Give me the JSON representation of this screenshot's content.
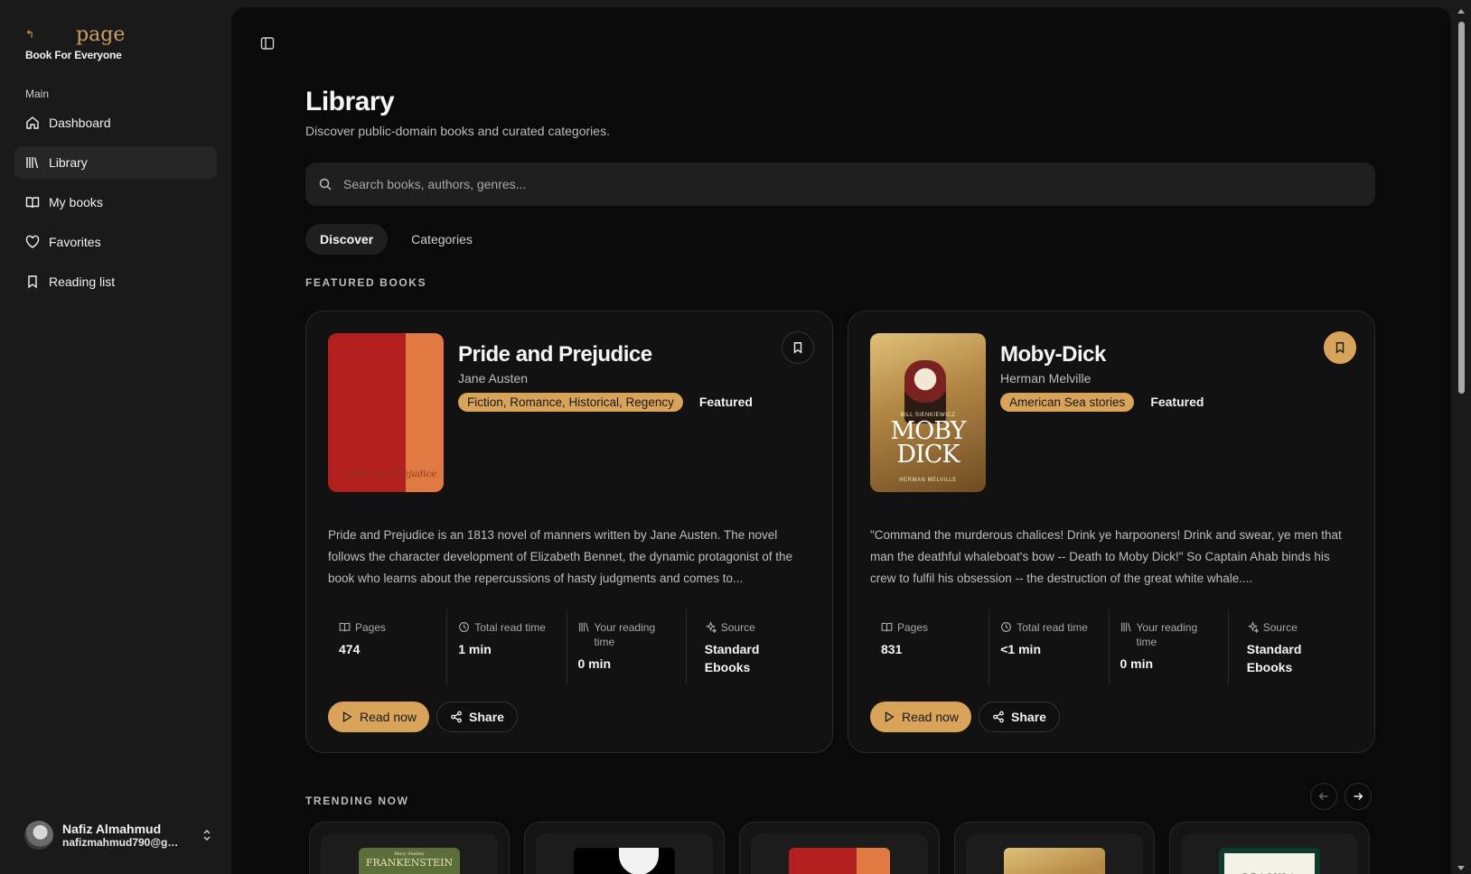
{
  "brand": {
    "logo_word": "page",
    "logo_arrow": "↰",
    "tagline": "Book For Everyone"
  },
  "sidebar": {
    "section_label": "Main",
    "items": [
      {
        "label": "Dashboard",
        "icon": "home-icon",
        "active": false
      },
      {
        "label": "Library",
        "icon": "library-icon",
        "active": true
      },
      {
        "label": "My books",
        "icon": "open-book-icon",
        "active": false
      },
      {
        "label": "Favorites",
        "icon": "heart-icon",
        "active": false
      },
      {
        "label": "Reading list",
        "icon": "bookmark-icon",
        "active": false
      }
    ]
  },
  "user": {
    "name": "Nafiz Almahmud",
    "email": "nafizmahmud790@gm..."
  },
  "header": {
    "title": "Library",
    "subtitle": "Discover public-domain books and curated categories."
  },
  "search": {
    "placeholder": "Search books, authors, genres...",
    "value": ""
  },
  "tabs": [
    {
      "label": "Discover",
      "active": true
    },
    {
      "label": "Categories",
      "active": false
    }
  ],
  "featured": {
    "label": "FEATURED BOOKS",
    "books": [
      {
        "title": "Pride and Prejudice",
        "author": "Jane Austen",
        "genre": "Fiction, Romance, Historical, Regency",
        "featured_badge": "Featured",
        "bookmarked": false,
        "cover_text": "Pride and Prejudice",
        "description": "Pride and Prejudice is an 1813 novel of manners written by Jane Austen. The novel follows the character development of Elizabeth Bennet, the dynamic protagonist of the book who learns about the repercussions of hasty judgments and comes to...",
        "stats": {
          "pages_label": "Pages",
          "pages": "474",
          "total_label": "Total read time",
          "total": "1 min",
          "yours_label": "Your reading time",
          "yours": "0 min",
          "source_label": "Source",
          "source": "Standard Ebooks"
        },
        "read_label": "Read now",
        "share_label": "Share"
      },
      {
        "title": "Moby-Dick",
        "author": "Herman Melville",
        "genre": "American Sea stories",
        "featured_badge": "Featured",
        "bookmarked": true,
        "cover_top": "BILL SIENKIEWICZ",
        "cover_title": "MOBY DICK",
        "cover_bottom": "HERMAN MELVILLE",
        "description": "\"Command the murderous chalices! Drink ye harpooners! Drink and swear, ye men that man the deathful whaleboat's bow -- Death to Moby Dick!\" So Captain Ahab binds his crew to fulfil his obsession -- the destruction of the great white whale....",
        "stats": {
          "pages_label": "Pages",
          "pages": "831",
          "total_label": "Total read time",
          "total": "<1 min",
          "yours_label": "Your reading time",
          "yours": "0 min",
          "source_label": "Source",
          "source": "Standard Ebooks"
        },
        "read_label": "Read now",
        "share_label": "Share"
      }
    ]
  },
  "trending": {
    "label": "TRENDING NOW",
    "items": [
      {
        "cover_text": "FRANKENSTEIN",
        "cover_small": "Mary Shelley"
      },
      {
        "cover_text": ""
      },
      {
        "cover_text": ""
      },
      {
        "cover_text": ""
      },
      {
        "cover_text": "DRACULA"
      }
    ]
  },
  "colors": {
    "accent": "#d9a35a",
    "background": "#0a0a0a",
    "sidebar": "#1a1a1a"
  }
}
